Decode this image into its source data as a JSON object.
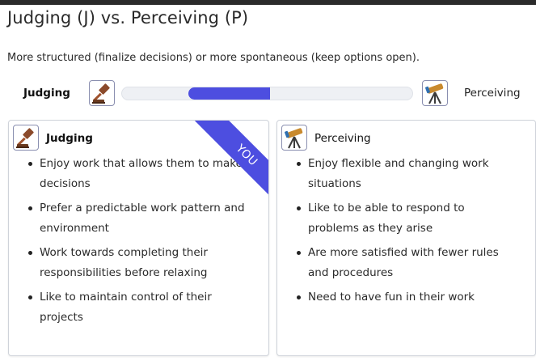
{
  "title": "Judging (J) vs. Perceiving (P)",
  "description": "More structured (finalize decisions) or more spontaneous (keep options open).",
  "scale": {
    "left_label": "Judging",
    "right_label": "Perceiving",
    "fill_start_fraction": 0.23,
    "fill_end_fraction": 0.51,
    "fill_color": "#4d4ee0"
  },
  "cards": {
    "judging": {
      "title": "Judging",
      "ribbon": "YOU",
      "icon": "gavel-icon",
      "items": [
        "Enjoy work that allows them to make decisions",
        "Prefer a predictable work pattern and environment",
        "Work towards completing their responsibilities before relaxing",
        "Like to maintain control of their projects"
      ]
    },
    "perceiving": {
      "title": "Perceiving",
      "icon": "telescope-icon",
      "items": [
        "Enjoy flexible and changing work situations",
        "Like to be able to respond to problems as they arise",
        "Are more satisfied with fewer rules and procedures",
        "Need to have fun in their work"
      ]
    }
  }
}
